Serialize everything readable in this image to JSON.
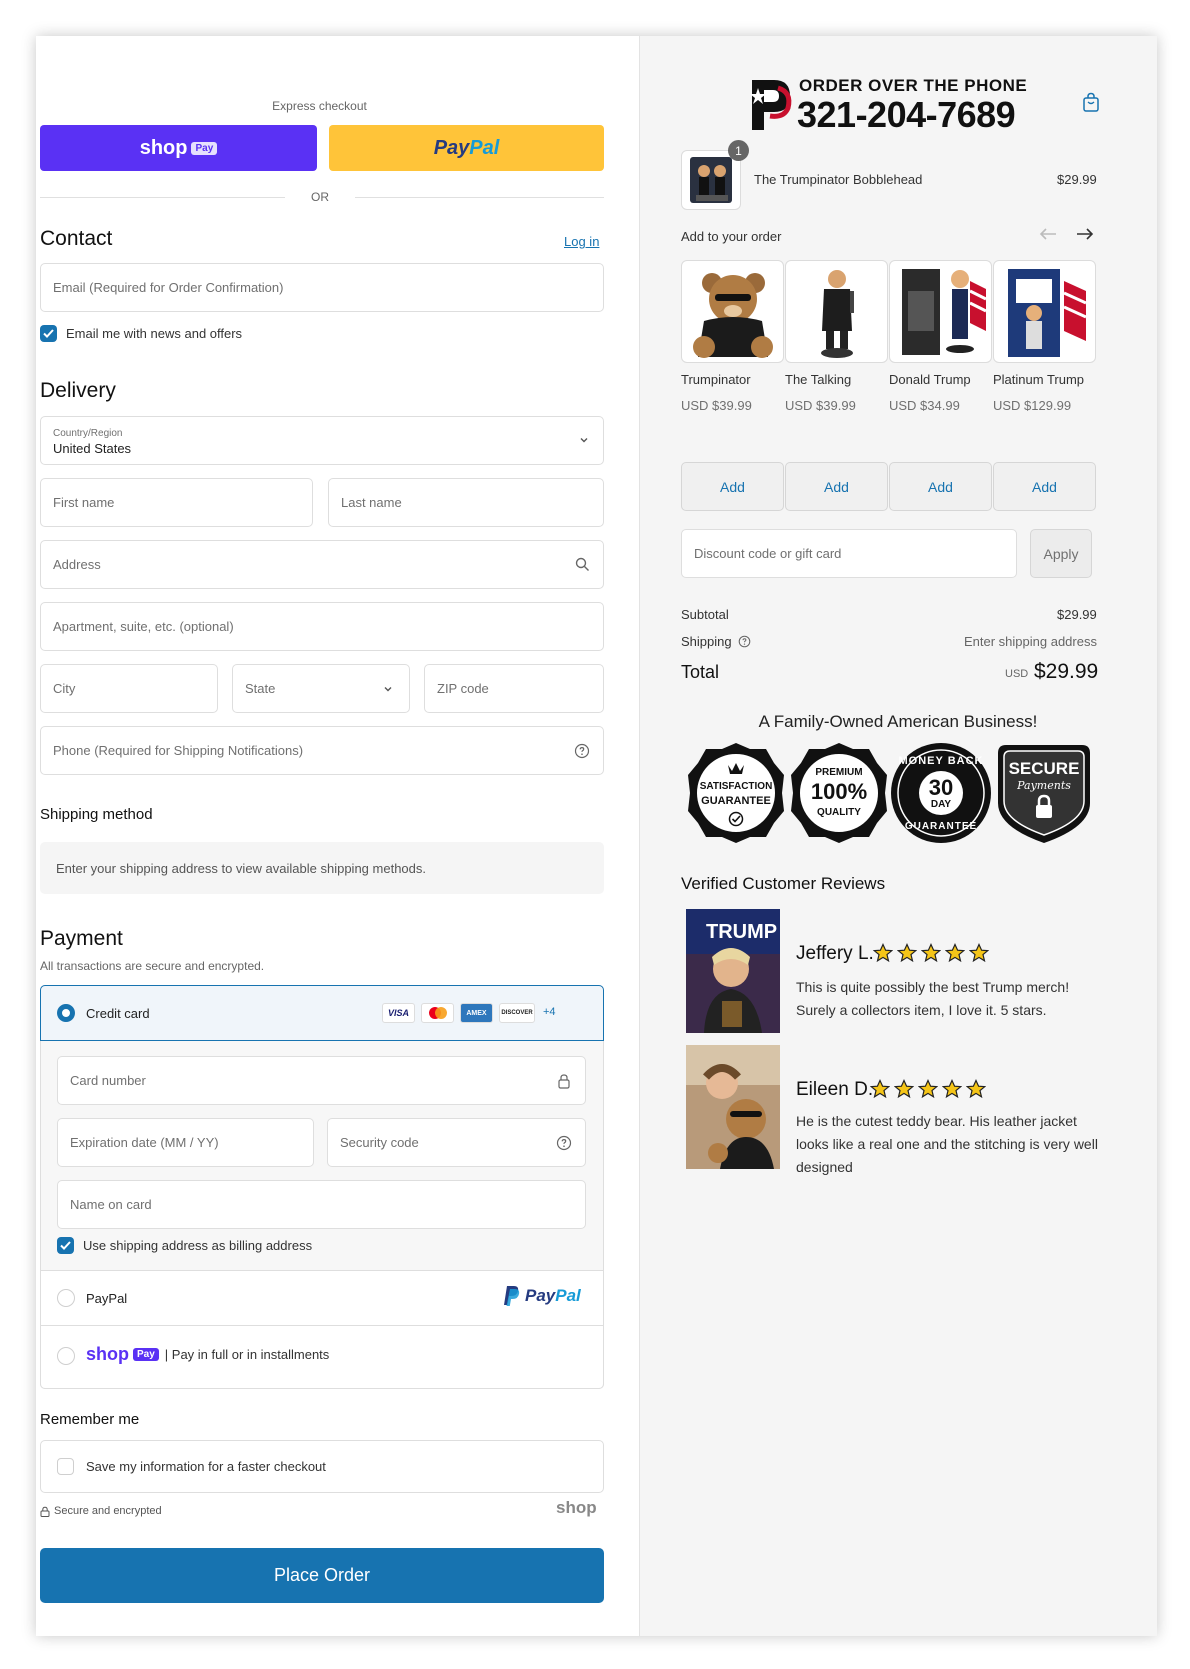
{
  "express": {
    "label": "Express checkout",
    "shop_word": "shop",
    "pay_word": "Pay",
    "paypal_pay": "Pay",
    "paypal_pal": "Pal",
    "or_label": "OR"
  },
  "contact": {
    "title": "Contact",
    "login": "Log in",
    "email_placeholder": "Email (Required for Order Confirmation)",
    "news_label": "Email me with news and offers"
  },
  "delivery": {
    "title": "Delivery",
    "country_label": "Country/Region",
    "country_value": "United States",
    "first_name": "First name",
    "last_name": "Last name",
    "address": "Address",
    "apartment": "Apartment, suite, etc. (optional)",
    "city": "City",
    "state": "State",
    "zip": "ZIP code",
    "phone": "Phone (Required for Shipping Notifications)"
  },
  "shipping_method": {
    "title": "Shipping method",
    "notice": "Enter your shipping address to view available shipping methods."
  },
  "payment": {
    "title": "Payment",
    "subtitle": "All transactions are secure and encrypted.",
    "credit_card_label": "Credit card",
    "cards": [
      "VISA",
      "",
      "AMEX",
      "DISCOVER"
    ],
    "more_cards": "+4",
    "card_number": "Card number",
    "expiration": "Expiration date (MM / YY)",
    "security_code": "Security code",
    "name_on_card": "Name on card",
    "billing_same": "Use shipping address as billing address",
    "paypal_label": "PayPal",
    "paypal_logo_pay": "Pay",
    "paypal_logo_pal": "Pal",
    "shop_word": "shop",
    "shop_pay": "Pay",
    "shop_installments": "| Pay in full or in installments"
  },
  "remember": {
    "title": "Remember me",
    "save_label": "Save my information for a faster checkout",
    "secure": "Secure and encrypted",
    "shop_logo": "shop"
  },
  "place_order": "Place Order",
  "header": {
    "order_phone_title": "ORDER OVER THE PHONE",
    "phone": "321-204-7689"
  },
  "cart": {
    "quantity": "1",
    "item_name": "The Trumpinator Bobblehead",
    "item_price": "$29.99"
  },
  "upsell": {
    "title": "Add to your order",
    "products": [
      {
        "name": "Trumpinator",
        "price": "USD $39.99",
        "add": "Add"
      },
      {
        "name": "The Talking",
        "price": "USD $39.99",
        "add": "Add"
      },
      {
        "name": "Donald Trump",
        "price": "USD $34.99",
        "add": "Add"
      },
      {
        "name": "Platinum Trump",
        "price": "USD $129.99",
        "add": "Add"
      }
    ]
  },
  "discount": {
    "placeholder": "Discount code or gift card",
    "apply": "Apply"
  },
  "summary": {
    "subtotal_label": "Subtotal",
    "subtotal_value": "$29.99",
    "shipping_label": "Shipping",
    "shipping_value": "Enter shipping address",
    "total_label": "Total",
    "total_currency": "USD",
    "total_value": "$29.99"
  },
  "trust": {
    "title": "A Family-Owned American Business!",
    "badge1_line1": "SATISFACTION",
    "badge1_line2": "GUARANTEE",
    "badge2_top": "PREMIUM",
    "badge2_mid": "100%",
    "badge2_bot": "QUALITY",
    "badge3_top": "MONEY BACK",
    "badge3_num": "30",
    "badge3_day": "DAY",
    "badge3_bot": "GUARANTEE",
    "badge4_top": "SECURE",
    "badge4_bot": "Payments"
  },
  "reviews": {
    "title": "Verified Customer Reviews",
    "items": [
      {
        "name": "Jeffery L.",
        "rating": 5,
        "text": "This is quite possibly the best Trump merch! Surely a collectors item, I love it. 5 stars.",
        "photo_text": "TRUMP"
      },
      {
        "name": "Eileen D.",
        "rating": 5,
        "text": "He is the cutest teddy bear. His leather jacket looks like a real one and the stitching is very well designed"
      }
    ]
  },
  "colors": {
    "accent": "#1773b0",
    "shop_purple": "#5a31f4",
    "paypal_yellow": "#ffc439",
    "star_yellow": "#f5c518"
  }
}
